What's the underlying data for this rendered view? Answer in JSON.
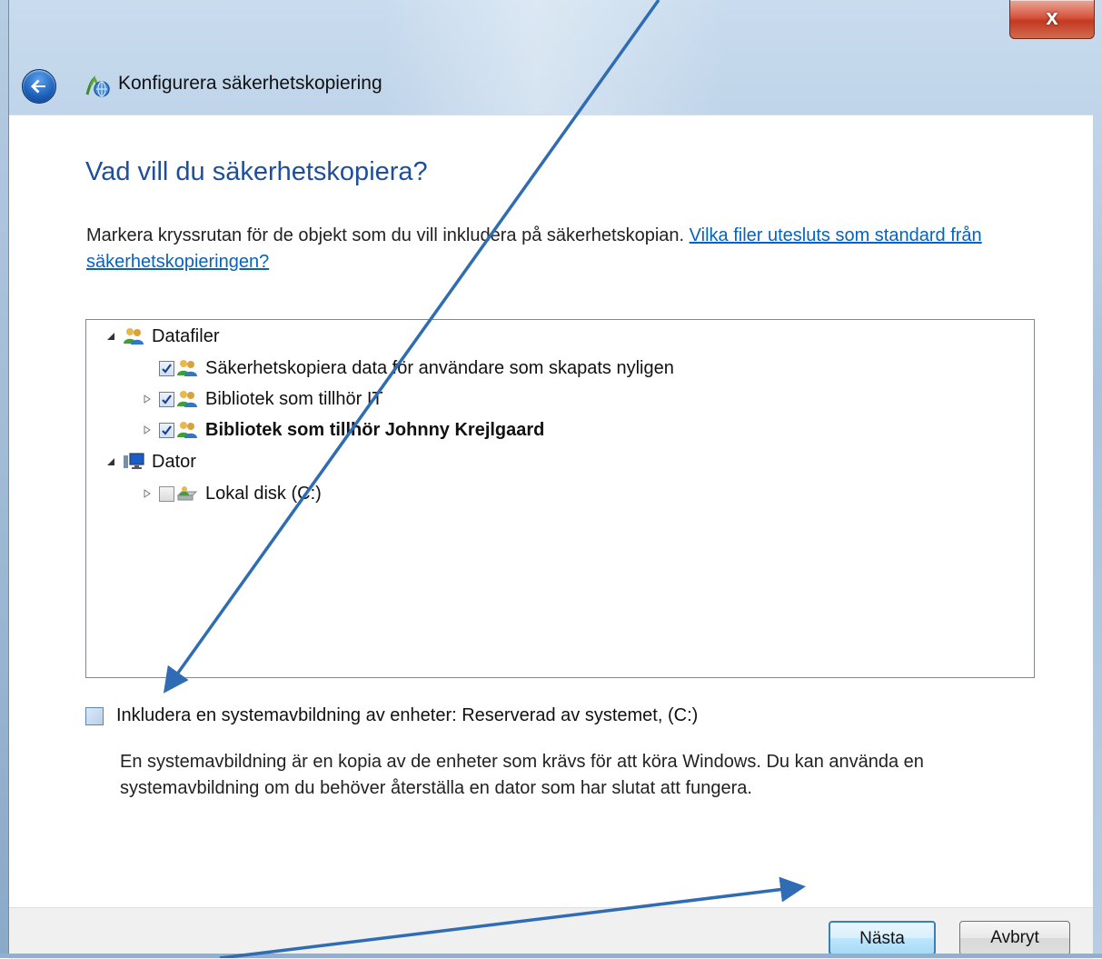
{
  "window": {
    "title": "Konfigurera säkerhetskopiering",
    "close_glyph": "x"
  },
  "page": {
    "heading": "Vad vill du säkerhetskopiera?",
    "instructions": "Markera kryssrutan för de objekt som du vill inkludera på säkerhetskopian.",
    "help_link": "Vilka filer utesluts som standard från säkerhetskopieringen?"
  },
  "tree": {
    "items": [
      {
        "label": "Datafiler",
        "level": 0,
        "expanded": true,
        "checkbox": false,
        "icon": "users-icon"
      },
      {
        "label": "Säkerhetskopiera data för användare som skapats nyligen",
        "level": 1,
        "expander": false,
        "checked": true,
        "icon": "users-icon"
      },
      {
        "label": "Bibliotek som tillhör IT",
        "level": 1,
        "expander": true,
        "checked": true,
        "icon": "users-icon"
      },
      {
        "label": "Bibliotek som tillhör Johnny Krejlgaard",
        "level": 1,
        "expander": true,
        "checked": true,
        "icon": "users-icon",
        "bold": true
      },
      {
        "label": "Dator",
        "level": 0,
        "expanded": true,
        "checkbox": false,
        "icon": "computer-icon"
      },
      {
        "label": "Lokal disk (C:)",
        "level": 1,
        "expander": true,
        "checked": false,
        "icon": "local-disk-icon"
      }
    ]
  },
  "system_image": {
    "label": "Inkludera en systemavbildning av enheter: Reserverad av systemet, (C:)",
    "checked": false,
    "description": "En systemavbildning är en kopia av de enheter som krävs för att köra Windows. Du kan använda en systemavbildning om du behöver återställa en dator som har slutat att fungera."
  },
  "buttons": {
    "next": "Nästa",
    "cancel": "Avbryt"
  },
  "colors": {
    "heading": "#1f4e9d",
    "link": "#0563c1",
    "annotation_arrow": "#2f6cb3"
  }
}
